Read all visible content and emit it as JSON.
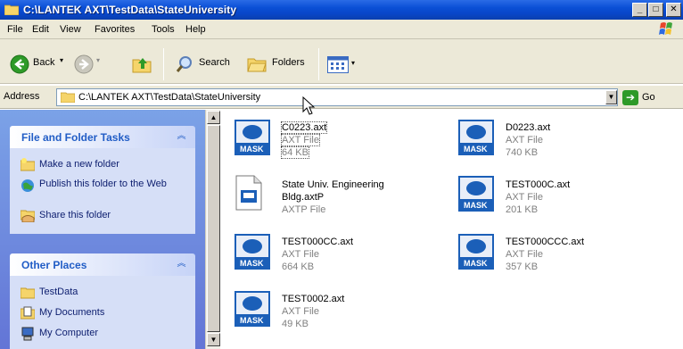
{
  "window": {
    "title": "C:\\LANTEK AXT\\TestData\\StateUniversity"
  },
  "menu": [
    "File",
    "Edit",
    "View",
    "Favorites",
    "Tools",
    "Help"
  ],
  "toolbar": {
    "back_label": "Back",
    "search_label": "Search",
    "folders_label": "Folders"
  },
  "address": {
    "label": "Address",
    "value": "C:\\LANTEK AXT\\TestData\\StateUniversity",
    "go_label": "Go"
  },
  "tasks": {
    "heading": "File and Folder Tasks",
    "items": [
      "Make a new folder",
      "Publish this folder to the Web",
      "Share this folder"
    ]
  },
  "places": {
    "heading": "Other Places",
    "items": [
      "TestData",
      "My Documents",
      "My Computer"
    ]
  },
  "files": [
    {
      "name": "C0223.axt",
      "type": "AXT File",
      "size": "64 KB",
      "icon": "mask-icon"
    },
    {
      "name": "D0223.axt",
      "type": "AXT File",
      "size": "740 KB",
      "icon": "mask-icon"
    },
    {
      "name_line1": "State Univ. Engineering",
      "name_line2": "Bldg.axtP",
      "type": "AXTP File",
      "icon": "axtp-file-icon"
    },
    {
      "name": "TEST000C.axt",
      "type": "AXT File",
      "size": "201 KB",
      "icon": "mask-icon"
    },
    {
      "name": "TEST000CC.axt",
      "type": "AXT File",
      "size": "664 KB",
      "icon": "mask-icon"
    },
    {
      "name": "TEST000CCC.axt",
      "type": "AXT File",
      "size": "357 KB",
      "icon": "mask-icon"
    },
    {
      "name": "TEST0002.axt",
      "type": "AXT File",
      "size": "49 KB",
      "icon": "mask-icon"
    }
  ],
  "mask_label": "MASK"
}
